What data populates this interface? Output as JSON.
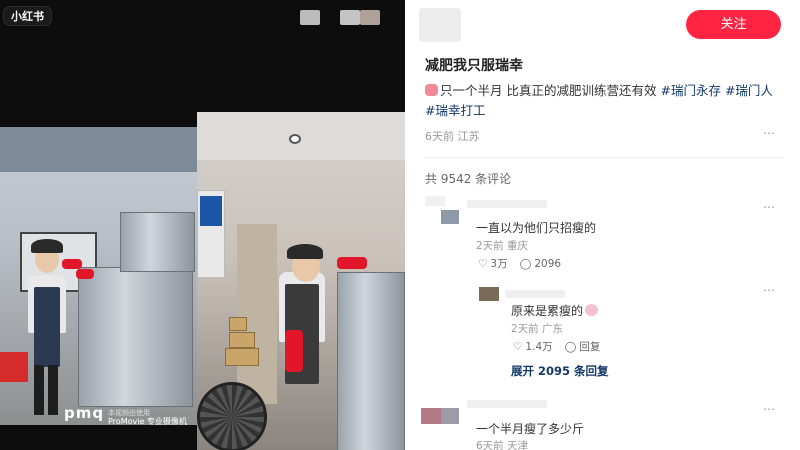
{
  "app": {
    "logo_text": "小红书"
  },
  "media": {
    "watermark_brand": "pmq",
    "watermark_sub": "本视频由使用",
    "watermark_caption": "ProMovie 专业摄像机"
  },
  "post": {
    "follow_label": "关注",
    "title": "减肥我只服瑞幸",
    "desc_text": "只一个半月 比真正的减肥训练营还有效",
    "tags": [
      "#瑞门永存",
      "#瑞门人",
      "#瑞幸打工"
    ],
    "date": "6天前",
    "location": "江苏",
    "more_icon": "ellipsis-icon"
  },
  "comments_section": {
    "count_label": "共 9542 条评论",
    "comments": [
      {
        "text": "一直以为他们只招瘦的",
        "date": "2天前",
        "location": "重庆",
        "likes": "3万",
        "replies": "2096",
        "reply_label": ""
      },
      {
        "text": "原来是累瘦的",
        "date": "2天前",
        "location": "广东",
        "likes": "1.4万",
        "replies": "",
        "reply_label": "回复"
      },
      {
        "text": "一个半月瘦了多少斤",
        "date": "6天前",
        "location": "天津"
      }
    ],
    "expand_label": "展开 2095 条回复"
  },
  "colors": {
    "accent": "#ff2442",
    "link": "#13386c"
  }
}
